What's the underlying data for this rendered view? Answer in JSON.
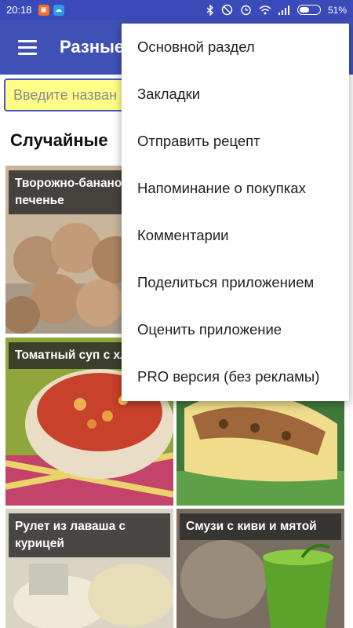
{
  "status_bar": {
    "time": "20:18",
    "battery": "51%",
    "battery_level": 0.51,
    "icons": [
      "app-notification-icon",
      "weather-icon",
      "bluetooth-icon",
      "do-not-disturb-icon",
      "alarm-icon",
      "wifi-icon",
      "signal-icon",
      "battery-icon"
    ]
  },
  "app_bar": {
    "title": "Разные"
  },
  "search": {
    "placeholder": "Введите назван"
  },
  "section": {
    "title": "Случайные"
  },
  "recipes": [
    {
      "title": "Творожно-бананов печенье"
    },
    {
      "title": "Томатный суп с хлебом"
    },
    {
      "title": ""
    },
    {
      "title": "Рулет из лаваша с курицей"
    },
    {
      "title": "Смузи с киви и мятой"
    }
  ],
  "menu": {
    "items": [
      {
        "label": "Основной раздел"
      },
      {
        "label": "Закладки"
      },
      {
        "label": "Отправить рецепт"
      },
      {
        "label": "Напоминание о покупках"
      },
      {
        "label": "Комментарии"
      },
      {
        "label": "Поделиться приложением"
      },
      {
        "label": "Оценить приложение"
      },
      {
        "label": "PRO версия (без рекламы)"
      }
    ]
  },
  "colors": {
    "primary": "#3f51b5",
    "status_bar": "#3a4ab8",
    "search_background": "#ffff88",
    "caption_background": "#282828"
  }
}
